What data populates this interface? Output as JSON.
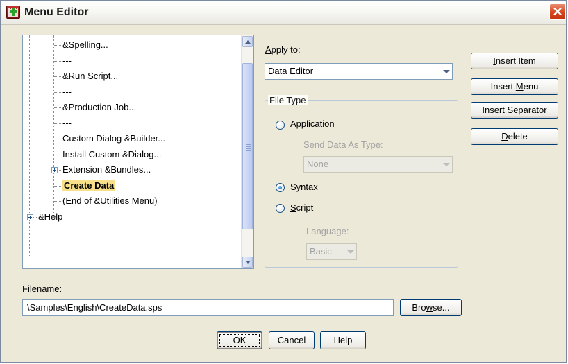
{
  "window": {
    "title": "Menu Editor",
    "close_glyph": "✕",
    "icon": "app-menu-editor-icon"
  },
  "menu": {
    "label_pre": "M",
    "label_u": "e",
    "label_post": "nu",
    "items": [
      {
        "text": "&Spelling...",
        "level": 2
      },
      {
        "text": "---",
        "level": 2
      },
      {
        "text": "&Run Script...",
        "level": 2
      },
      {
        "text": "---",
        "level": 2
      },
      {
        "text": "&Production Job...",
        "level": 2
      },
      {
        "text": "---",
        "level": 2
      },
      {
        "text": "Custom Dialog &Builder...",
        "level": 2
      },
      {
        "text": "Install Custom &Dialog...",
        "level": 2
      },
      {
        "text": "Extension &Bundles...",
        "level": 2,
        "expandable": true
      },
      {
        "text": "Create Data",
        "level": 2,
        "selected": true
      },
      {
        "text": "(End of &Utilities Menu)",
        "level": 2
      },
      {
        "text": "&Help",
        "level": 1,
        "expandable": true
      }
    ]
  },
  "apply_to": {
    "label_pre": "",
    "label_u": "A",
    "label_post": "pply to:",
    "value": "Data Editor"
  },
  "file_type": {
    "legend": "File Type",
    "application": {
      "pre": "",
      "u": "A",
      "post": "pplication",
      "checked": false
    },
    "send_data_label": "Send Data As Type:",
    "send_data_value": "None",
    "syntax": {
      "pre": "Synta",
      "u": "x",
      "post": "",
      "checked": true
    },
    "script": {
      "pre": "",
      "u": "S",
      "post": "cript",
      "checked": false
    },
    "language_label": "Language:",
    "language_value": "Basic"
  },
  "buttons": {
    "insert_item": {
      "pre": "",
      "u": "I",
      "post": "nsert Item"
    },
    "insert_menu": {
      "pre": "Insert ",
      "u": "M",
      "post": "enu"
    },
    "insert_separator": {
      "pre": "In",
      "u": "s",
      "post": "ert Separator"
    },
    "delete": {
      "pre": "",
      "u": "D",
      "post": "elete"
    },
    "browse": {
      "pre": "Bro",
      "u": "w",
      "post": "se..."
    },
    "ok": "OK",
    "cancel": "Cancel",
    "help": "Help"
  },
  "filename": {
    "label_pre": "",
    "label_u": "F",
    "label_post": "ilename:",
    "value": "\\Samples\\English\\CreateData.sps"
  },
  "colors": {
    "selection": "#f8df8a",
    "border_blue": "#7f9db9",
    "close_red": "#d6451e"
  }
}
